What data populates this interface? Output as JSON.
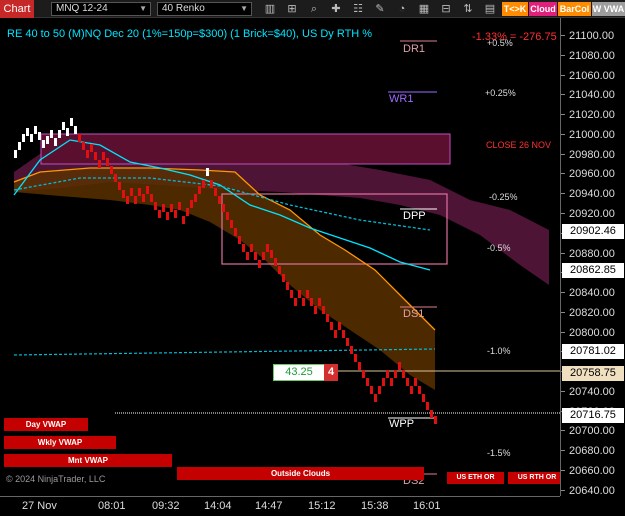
{
  "toolbar": {
    "chart_label": "Chart",
    "instrument": "MNQ 12-24",
    "bar_type": "40 Renko",
    "tags": [
      {
        "label": "T<>K",
        "color": "#ff8c00"
      },
      {
        "label": "Cloud",
        "color": "#e0207a"
      },
      {
        "label": "BarCol",
        "color": "#ff8c00"
      },
      {
        "label": "W VWA",
        "color": "#9e9e9e"
      }
    ]
  },
  "title": "RE 40 to 50 (M)NQ Dec 20 (1%=150p=$300) (1 Brick=$40), US Dy RTH %",
  "status": "-1.33% = -276.75",
  "price_axis": {
    "ticks": [
      "21100.00",
      "21080.00",
      "21060.00",
      "21040.00",
      "21020.00",
      "21000.00",
      "20980.00",
      "20960.00",
      "20940.00",
      "20920.00",
      "20900.00",
      "20880.00",
      "20860.00",
      "20840.00",
      "20820.00",
      "20800.00",
      "20780.00",
      "20760.00",
      "20740.00",
      "20720.00",
      "20700.00",
      "20680.00",
      "20660.00",
      "20640.00"
    ],
    "labels": [
      {
        "value": "20902.46",
        "bg": "#ffffff",
        "fg": "#000000"
      },
      {
        "value": "20862.85",
        "bg": "#ffffff",
        "fg": "#000000"
      },
      {
        "value": "20781.02",
        "bg": "#ffffff",
        "fg": "#000000"
      },
      {
        "value": "20758.75",
        "bg": "#f0e0c0",
        "fg": "#000000"
      },
      {
        "value": "20716.75",
        "bg": "#ffffff",
        "fg": "#000000"
      }
    ]
  },
  "time_axis": [
    "27 Nov",
    "08:01",
    "09:32",
    "14:04",
    "14:47",
    "15:12",
    "15:38",
    "16:01"
  ],
  "pivots": {
    "dr1": "DR1",
    "wr1": "WR1",
    "dpp": "DPP",
    "ds1": "DS1",
    "wpp": "WPP",
    "ds2": "DS2"
  },
  "percent_labels": {
    "p05": "+0.5%",
    "p025": "+0.25%",
    "close": "CLOSE 26 NOV",
    "m025": "-0.25%",
    "m05": "-0.5%",
    "m10": "-1.0%",
    "m15": "-1.5%"
  },
  "marker": {
    "value": "43.25",
    "count": "4"
  },
  "panel_buttons": {
    "day_vwap": "Day VWAP",
    "wkly_vwap": "Wkly VWAP",
    "mnt_vwap": "Mnt VWAP",
    "outside_clouds": "Outside Clouds",
    "us_eth_or": "US ETH OR",
    "us_rth_or": "US RTH OR"
  },
  "watermark": "© 2024 NinjaTrader, LLC"
}
